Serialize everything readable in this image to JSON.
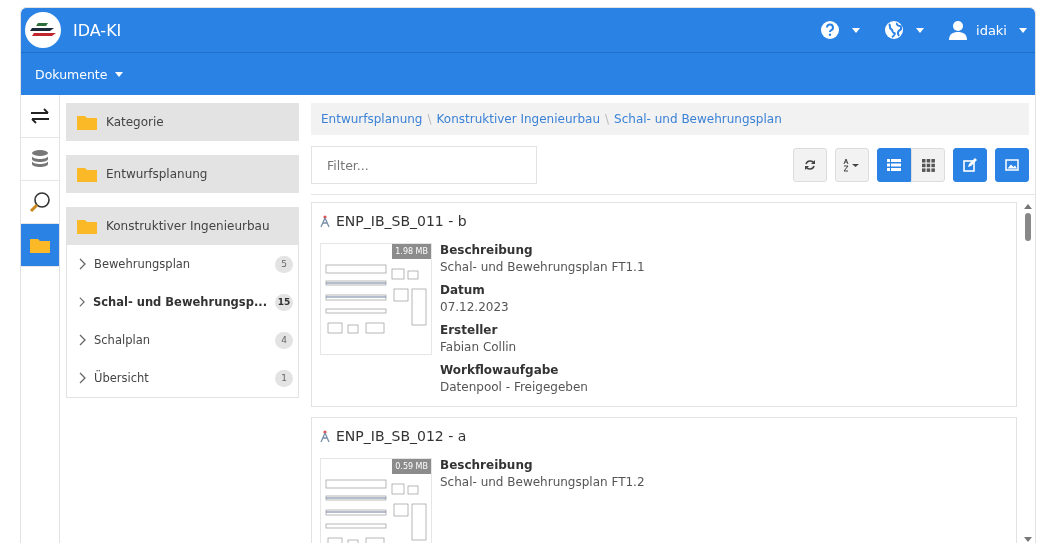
{
  "app": {
    "title": "IDA-KI",
    "user": "idaki"
  },
  "nav": {
    "menu": "Dokumente"
  },
  "rail": [
    {
      "kind": "transfer",
      "selected": false
    },
    {
      "kind": "database",
      "selected": false
    },
    {
      "kind": "search",
      "selected": false
    },
    {
      "kind": "folder",
      "selected": true
    }
  ],
  "tree": {
    "groups": [
      {
        "label": "Kategorie"
      },
      {
        "label": "Entwurfsplanung"
      },
      {
        "label": "Konstruktiver Ingenieurbau"
      }
    ],
    "items": [
      {
        "label": "Bewehrungsplan",
        "count": "5",
        "selected": false
      },
      {
        "label": "Schal- und Bewehrungsp...",
        "count": "15",
        "selected": true
      },
      {
        "label": "Schalplan",
        "count": "4",
        "selected": false
      },
      {
        "label": "Übersicht",
        "count": "1",
        "selected": false
      }
    ]
  },
  "breadcrumb": [
    {
      "label": "Entwurfsplanung"
    },
    {
      "separator": "\\",
      "label": "Konstruktiver Ingenieurbau"
    },
    {
      "separator": "\\",
      "label": "Schal- und Bewehrungsplan"
    }
  ],
  "filter": {
    "placeholder": "Filter..."
  },
  "view": [
    {
      "kind": "list",
      "selected": true
    },
    {
      "kind": "grid",
      "selected": false
    }
  ],
  "documents": [
    {
      "title": "ENP_IB_SB_011 - b",
      "size": "1.98 MB",
      "fields": [
        {
          "label": "Beschreibung",
          "value": "Schal- und Bewehrungsplan FT1.1"
        },
        {
          "label": "Datum",
          "value": "07.12.2023"
        },
        {
          "label": "Ersteller",
          "value": "Fabian Collin"
        },
        {
          "label": "Workflowaufgabe",
          "value": "Datenpool - Freigegeben"
        }
      ]
    },
    {
      "title": "ENP_IB_SB_012 - a",
      "size": "0.59 MB",
      "fields": [
        {
          "label": "Beschreibung",
          "value": "Schal- und Bewehrungsplan FT1.2"
        }
      ]
    }
  ]
}
